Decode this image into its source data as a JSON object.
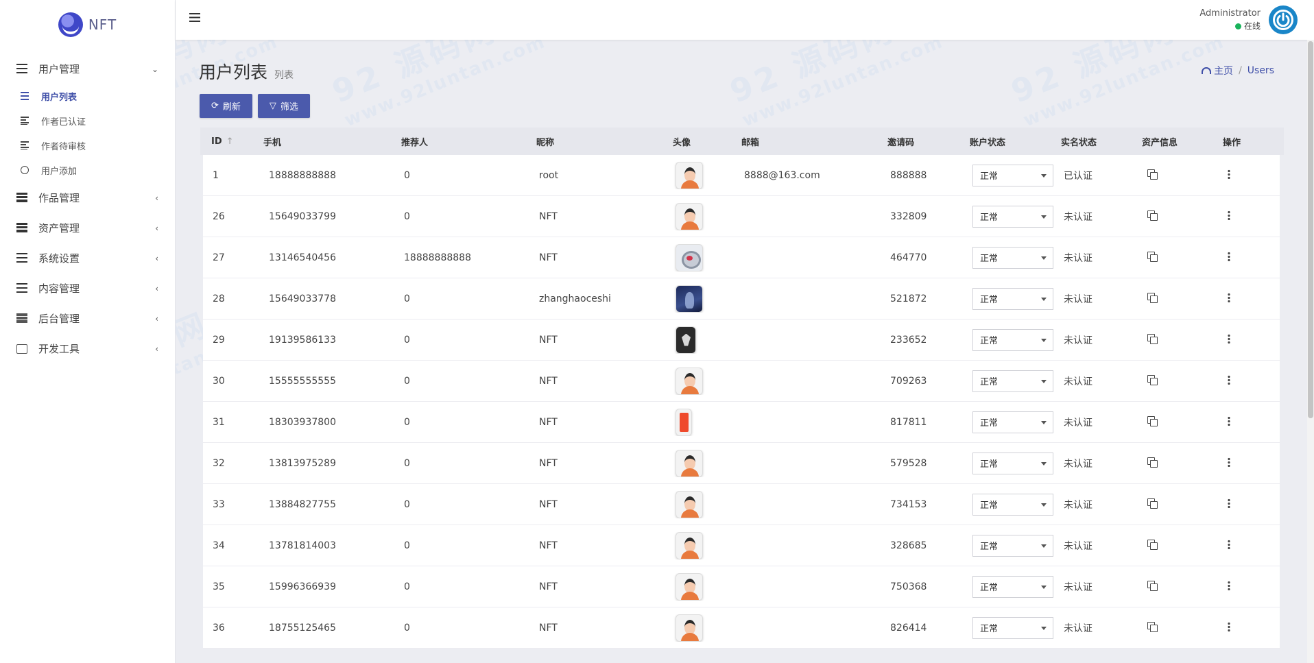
{
  "app": {
    "logo_text": "NFT"
  },
  "sidebar": {
    "menus": [
      {
        "label": "用户管理",
        "icon": "bars-icon",
        "expanded": true,
        "children": [
          {
            "label": "用户列表",
            "icon": "list-icon",
            "active": true
          },
          {
            "label": "作者已认证",
            "icon": "align-left-icon"
          },
          {
            "label": "作者待审核",
            "icon": "align-left-icon"
          },
          {
            "label": "用户添加",
            "icon": "circle-icon"
          }
        ]
      },
      {
        "label": "作品管理",
        "icon": "stack-icon"
      },
      {
        "label": "资产管理",
        "icon": "stack-icon"
      },
      {
        "label": "系统设置",
        "icon": "bars-icon"
      },
      {
        "label": "内容管理",
        "icon": "bars-icon"
      },
      {
        "label": "后台管理",
        "icon": "server-icon"
      },
      {
        "label": "开发工具",
        "icon": "keyboard-icon"
      }
    ]
  },
  "topbar": {
    "user_name": "Administrator",
    "user_status": "在线",
    "status_color": "#19b35b",
    "power_color": "#1a86c8"
  },
  "page": {
    "title": "用户列表",
    "subtitle": "列表",
    "breadcrumb": {
      "home": "主页",
      "current": "Users"
    },
    "buttons": {
      "refresh": "刷新",
      "filter": "筛选"
    },
    "accent_color": "#4b5aac"
  },
  "table": {
    "columns": {
      "id": "ID",
      "phone": "手机",
      "referrer": "推荐人",
      "nickname": "昵称",
      "avatar": "头像",
      "email": "邮箱",
      "invite_code": "邀请码",
      "account_status": "账户状态",
      "realname_status": "实名状态",
      "assets": "资产信息",
      "actions": "操作"
    },
    "sort_indicator": "↑",
    "rows": [
      {
        "id": "1",
        "phone": "18888888888",
        "referrer": "0",
        "nickname": "root",
        "avatar": "default",
        "email": "8888@163.com",
        "invite_code": "888888",
        "account_status": "正常",
        "realname_status": "已认证"
      },
      {
        "id": "26",
        "phone": "15649033799",
        "referrer": "0",
        "nickname": "NFT",
        "avatar": "default",
        "email": "",
        "invite_code": "332809",
        "account_status": "正常",
        "realname_status": "未认证"
      },
      {
        "id": "27",
        "phone": "13146540456",
        "referrer": "18888888888",
        "nickname": "NFT",
        "avatar": "robot",
        "email": "",
        "invite_code": "464770",
        "account_status": "正常",
        "realname_status": "未认证"
      },
      {
        "id": "28",
        "phone": "15649033778",
        "referrer": "0",
        "nickname": "zhanghaoceshi",
        "avatar": "dark",
        "email": "",
        "invite_code": "521872",
        "account_status": "正常",
        "realname_status": "未认证"
      },
      {
        "id": "29",
        "phone": "19139586133",
        "referrer": "0",
        "nickname": "NFT",
        "avatar": "bw",
        "email": "",
        "invite_code": "233652",
        "account_status": "正常",
        "realname_status": "未认证"
      },
      {
        "id": "30",
        "phone": "15555555555",
        "referrer": "0",
        "nickname": "NFT",
        "avatar": "default",
        "email": "",
        "invite_code": "709263",
        "account_status": "正常",
        "realname_status": "未认证"
      },
      {
        "id": "31",
        "phone": "18303937800",
        "referrer": "0",
        "nickname": "NFT",
        "avatar": "phone",
        "email": "",
        "invite_code": "817811",
        "account_status": "正常",
        "realname_status": "未认证"
      },
      {
        "id": "32",
        "phone": "13813975289",
        "referrer": "0",
        "nickname": "NFT",
        "avatar": "default",
        "email": "",
        "invite_code": "579528",
        "account_status": "正常",
        "realname_status": "未认证"
      },
      {
        "id": "33",
        "phone": "13884827755",
        "referrer": "0",
        "nickname": "NFT",
        "avatar": "default",
        "email": "",
        "invite_code": "734153",
        "account_status": "正常",
        "realname_status": "未认证"
      },
      {
        "id": "34",
        "phone": "13781814003",
        "referrer": "0",
        "nickname": "NFT",
        "avatar": "default",
        "email": "",
        "invite_code": "328685",
        "account_status": "正常",
        "realname_status": "未认证"
      },
      {
        "id": "35",
        "phone": "15996366939",
        "referrer": "0",
        "nickname": "NFT",
        "avatar": "default",
        "email": "",
        "invite_code": "750368",
        "account_status": "正常",
        "realname_status": "未认证"
      },
      {
        "id": "36",
        "phone": "18755125465",
        "referrer": "0",
        "nickname": "NFT",
        "avatar": "default",
        "email": "",
        "invite_code": "826414",
        "account_status": "正常",
        "realname_status": "未认证"
      }
    ]
  },
  "watermark": {
    "main": "92 源码网",
    "url": "www.92luntan.com"
  }
}
